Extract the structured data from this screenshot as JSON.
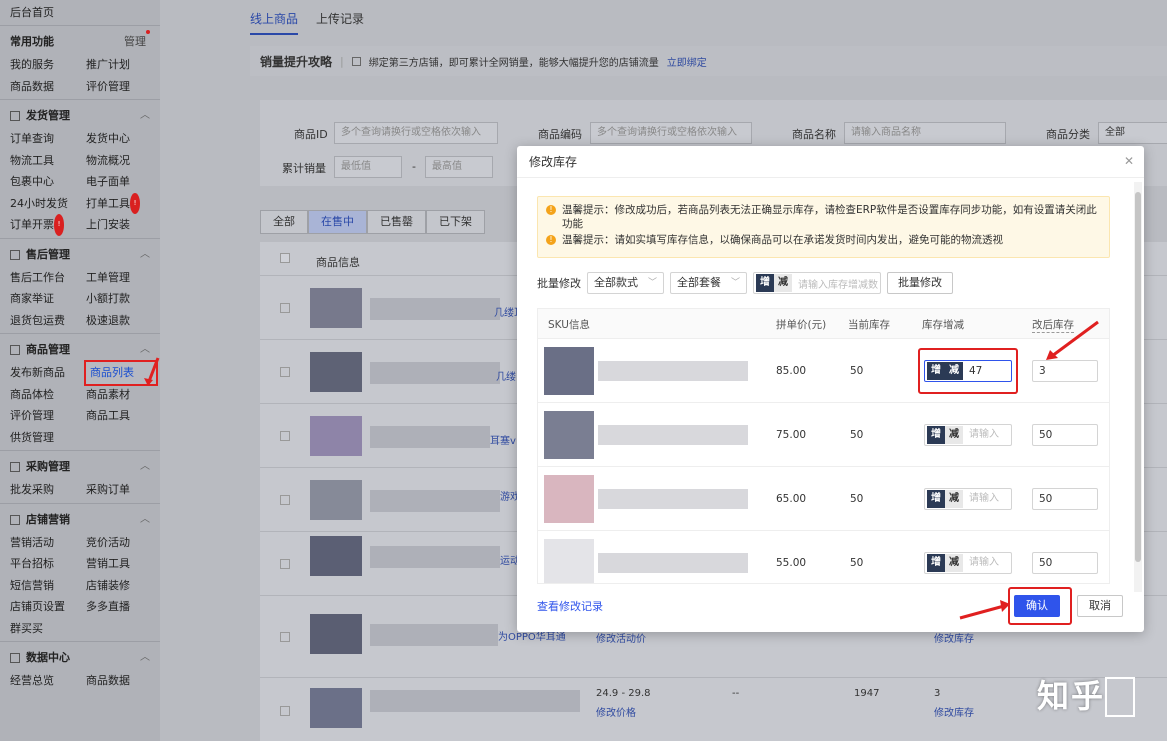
{
  "sidebar": {
    "top": "后台首页",
    "sections": [
      {
        "title": "常用功能",
        "right": "管理",
        "items": [
          "我的服务",
          "推广计划",
          "商品数据",
          "评价管理"
        ]
      },
      {
        "title": "发货管理",
        "items": [
          "订单查询",
          "发货中心",
          "物流工具",
          "物流概况",
          "包裹中心",
          "电子面单",
          "24小时发货",
          "打单工具",
          "订单开票",
          "上门安装"
        ]
      },
      {
        "title": "售后管理",
        "items": [
          "售后工作台",
          "工单管理",
          "商家举证",
          "小额打款",
          "退货包运费",
          "极速退款"
        ]
      },
      {
        "title": "商品管理",
        "items": [
          "发布新商品",
          "商品列表",
          "商品体检",
          "商品素材",
          "评价管理",
          "商品工具",
          "供货管理"
        ]
      },
      {
        "title": "采购管理",
        "items": [
          "批发采购",
          "采购订单"
        ]
      },
      {
        "title": "店铺营销",
        "items": [
          "营销活动",
          "竞价活动",
          "平台招标",
          "营销工具",
          "短信营销",
          "店铺装修",
          "店铺页设置",
          "多多直播",
          "群买买"
        ]
      },
      {
        "title": "数据中心",
        "items": [
          "经营总览",
          "商品数据"
        ]
      }
    ]
  },
  "main": {
    "tabs": [
      "线上商品",
      "上传记录"
    ],
    "promo_title": "销量提升攻略",
    "promo_text": "绑定第三方店铺，即可累计全网销量，能够大幅提升您的店铺流量",
    "promo_link": "立即绑定",
    "filters": {
      "id_label": "商品ID",
      "id_ph": "多个查询请换行或空格依次输入",
      "code_label": "商品编码",
      "code_ph": "多个查询请换行或空格依次输入",
      "name_label": "商品名称",
      "name_ph": "请输入商品名称",
      "cat_label": "商品分类",
      "cat_value": "全部",
      "sales_label": "累计销量",
      "min_ph": "最低值",
      "dash": "-",
      "max_ph": "最高值"
    },
    "status_tabs": [
      "全部",
      "在售中",
      "已售罄",
      "已下架"
    ],
    "table_header": "商品信息",
    "rows_text": [
      {
        "title": "几缕耳",
        "price": "",
        "sales": "",
        "stock": ""
      },
      {
        "title": "几缕",
        "price": "",
        "sales": "",
        "stock": ""
      },
      {
        "title": "耳塞v",
        "price": "",
        "sales": "",
        "stock": ""
      },
      {
        "title": "游戏耳",
        "price": "",
        "sales": "",
        "stock": ""
      },
      {
        "title": "运动耳",
        "price": "",
        "sales": "",
        "stock": ""
      },
      {
        "title": "为OPPO华耳通",
        "price": "修改活动价",
        "sales": "",
        "stock": "修改库存"
      },
      {
        "title": "",
        "price_range": "24.9 - 29.8",
        "price": "修改价格",
        "dash": "--",
        "sales": "1947",
        "stock_num": "3",
        "stock": "修改库存"
      }
    ]
  },
  "modal": {
    "title": "修改库存",
    "tip1": "温馨提示：修改成功后，若商品列表无法正确显示库存，请检查ERP软件是否设置库存同步功能，如有设置请关闭此功能",
    "tip2": "温馨提示：请如实填写库存信息，以确保商品可以在承诺发货时间内发出，避免可能的物流透视",
    "bulk_label": "批量修改",
    "style_select": "全部款式",
    "package_select": "全部套餐",
    "inc": "增",
    "dec": "减",
    "bulk_placeholder": "请输入库存增减数",
    "bulk_button": "批量修改",
    "columns": [
      "SKU信息",
      "拼单价(元)",
      "当前库存",
      "库存增减",
      "改后库存"
    ],
    "rows": [
      {
        "price": "85.00",
        "stock": "50",
        "delta": "47",
        "after": "3"
      },
      {
        "price": "75.00",
        "stock": "50",
        "delta": "请输入",
        "after": "50"
      },
      {
        "price": "65.00",
        "stock": "50",
        "delta": "请输入",
        "after": "50"
      },
      {
        "price": "55.00",
        "stock": "50",
        "delta": "请输入",
        "after": "50"
      }
    ],
    "view_log": "查看修改记录",
    "confirm": "确认",
    "cancel": "取消"
  },
  "watermark": "知乎"
}
